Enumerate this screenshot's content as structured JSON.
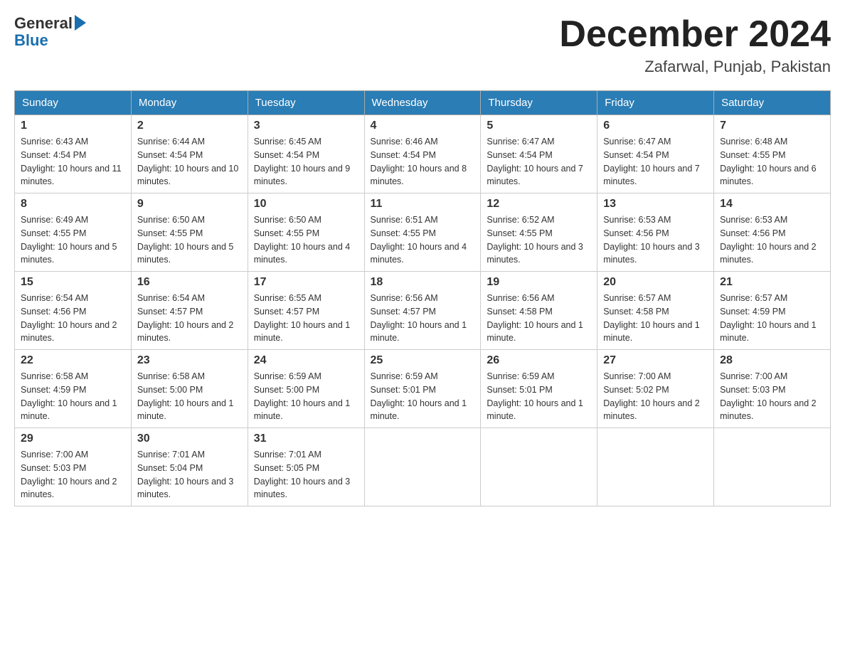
{
  "header": {
    "logo_general": "General",
    "logo_blue": "Blue",
    "month_title": "December 2024",
    "location": "Zafarwal, Punjab, Pakistan"
  },
  "days_of_week": [
    "Sunday",
    "Monday",
    "Tuesday",
    "Wednesday",
    "Thursday",
    "Friday",
    "Saturday"
  ],
  "weeks": [
    [
      {
        "day": "1",
        "sunrise": "6:43 AM",
        "sunset": "4:54 PM",
        "daylight": "10 hours and 11 minutes."
      },
      {
        "day": "2",
        "sunrise": "6:44 AM",
        "sunset": "4:54 PM",
        "daylight": "10 hours and 10 minutes."
      },
      {
        "day": "3",
        "sunrise": "6:45 AM",
        "sunset": "4:54 PM",
        "daylight": "10 hours and 9 minutes."
      },
      {
        "day": "4",
        "sunrise": "6:46 AM",
        "sunset": "4:54 PM",
        "daylight": "10 hours and 8 minutes."
      },
      {
        "day": "5",
        "sunrise": "6:47 AM",
        "sunset": "4:54 PM",
        "daylight": "10 hours and 7 minutes."
      },
      {
        "day": "6",
        "sunrise": "6:47 AM",
        "sunset": "4:54 PM",
        "daylight": "10 hours and 7 minutes."
      },
      {
        "day": "7",
        "sunrise": "6:48 AM",
        "sunset": "4:55 PM",
        "daylight": "10 hours and 6 minutes."
      }
    ],
    [
      {
        "day": "8",
        "sunrise": "6:49 AM",
        "sunset": "4:55 PM",
        "daylight": "10 hours and 5 minutes."
      },
      {
        "day": "9",
        "sunrise": "6:50 AM",
        "sunset": "4:55 PM",
        "daylight": "10 hours and 5 minutes."
      },
      {
        "day": "10",
        "sunrise": "6:50 AM",
        "sunset": "4:55 PM",
        "daylight": "10 hours and 4 minutes."
      },
      {
        "day": "11",
        "sunrise": "6:51 AM",
        "sunset": "4:55 PM",
        "daylight": "10 hours and 4 minutes."
      },
      {
        "day": "12",
        "sunrise": "6:52 AM",
        "sunset": "4:55 PM",
        "daylight": "10 hours and 3 minutes."
      },
      {
        "day": "13",
        "sunrise": "6:53 AM",
        "sunset": "4:56 PM",
        "daylight": "10 hours and 3 minutes."
      },
      {
        "day": "14",
        "sunrise": "6:53 AM",
        "sunset": "4:56 PM",
        "daylight": "10 hours and 2 minutes."
      }
    ],
    [
      {
        "day": "15",
        "sunrise": "6:54 AM",
        "sunset": "4:56 PM",
        "daylight": "10 hours and 2 minutes."
      },
      {
        "day": "16",
        "sunrise": "6:54 AM",
        "sunset": "4:57 PM",
        "daylight": "10 hours and 2 minutes."
      },
      {
        "day": "17",
        "sunrise": "6:55 AM",
        "sunset": "4:57 PM",
        "daylight": "10 hours and 1 minute."
      },
      {
        "day": "18",
        "sunrise": "6:56 AM",
        "sunset": "4:57 PM",
        "daylight": "10 hours and 1 minute."
      },
      {
        "day": "19",
        "sunrise": "6:56 AM",
        "sunset": "4:58 PM",
        "daylight": "10 hours and 1 minute."
      },
      {
        "day": "20",
        "sunrise": "6:57 AM",
        "sunset": "4:58 PM",
        "daylight": "10 hours and 1 minute."
      },
      {
        "day": "21",
        "sunrise": "6:57 AM",
        "sunset": "4:59 PM",
        "daylight": "10 hours and 1 minute."
      }
    ],
    [
      {
        "day": "22",
        "sunrise": "6:58 AM",
        "sunset": "4:59 PM",
        "daylight": "10 hours and 1 minute."
      },
      {
        "day": "23",
        "sunrise": "6:58 AM",
        "sunset": "5:00 PM",
        "daylight": "10 hours and 1 minute."
      },
      {
        "day": "24",
        "sunrise": "6:59 AM",
        "sunset": "5:00 PM",
        "daylight": "10 hours and 1 minute."
      },
      {
        "day": "25",
        "sunrise": "6:59 AM",
        "sunset": "5:01 PM",
        "daylight": "10 hours and 1 minute."
      },
      {
        "day": "26",
        "sunrise": "6:59 AM",
        "sunset": "5:01 PM",
        "daylight": "10 hours and 1 minute."
      },
      {
        "day": "27",
        "sunrise": "7:00 AM",
        "sunset": "5:02 PM",
        "daylight": "10 hours and 2 minutes."
      },
      {
        "day": "28",
        "sunrise": "7:00 AM",
        "sunset": "5:03 PM",
        "daylight": "10 hours and 2 minutes."
      }
    ],
    [
      {
        "day": "29",
        "sunrise": "7:00 AM",
        "sunset": "5:03 PM",
        "daylight": "10 hours and 2 minutes."
      },
      {
        "day": "30",
        "sunrise": "7:01 AM",
        "sunset": "5:04 PM",
        "daylight": "10 hours and 3 minutes."
      },
      {
        "day": "31",
        "sunrise": "7:01 AM",
        "sunset": "5:05 PM",
        "daylight": "10 hours and 3 minutes."
      },
      null,
      null,
      null,
      null
    ]
  ]
}
